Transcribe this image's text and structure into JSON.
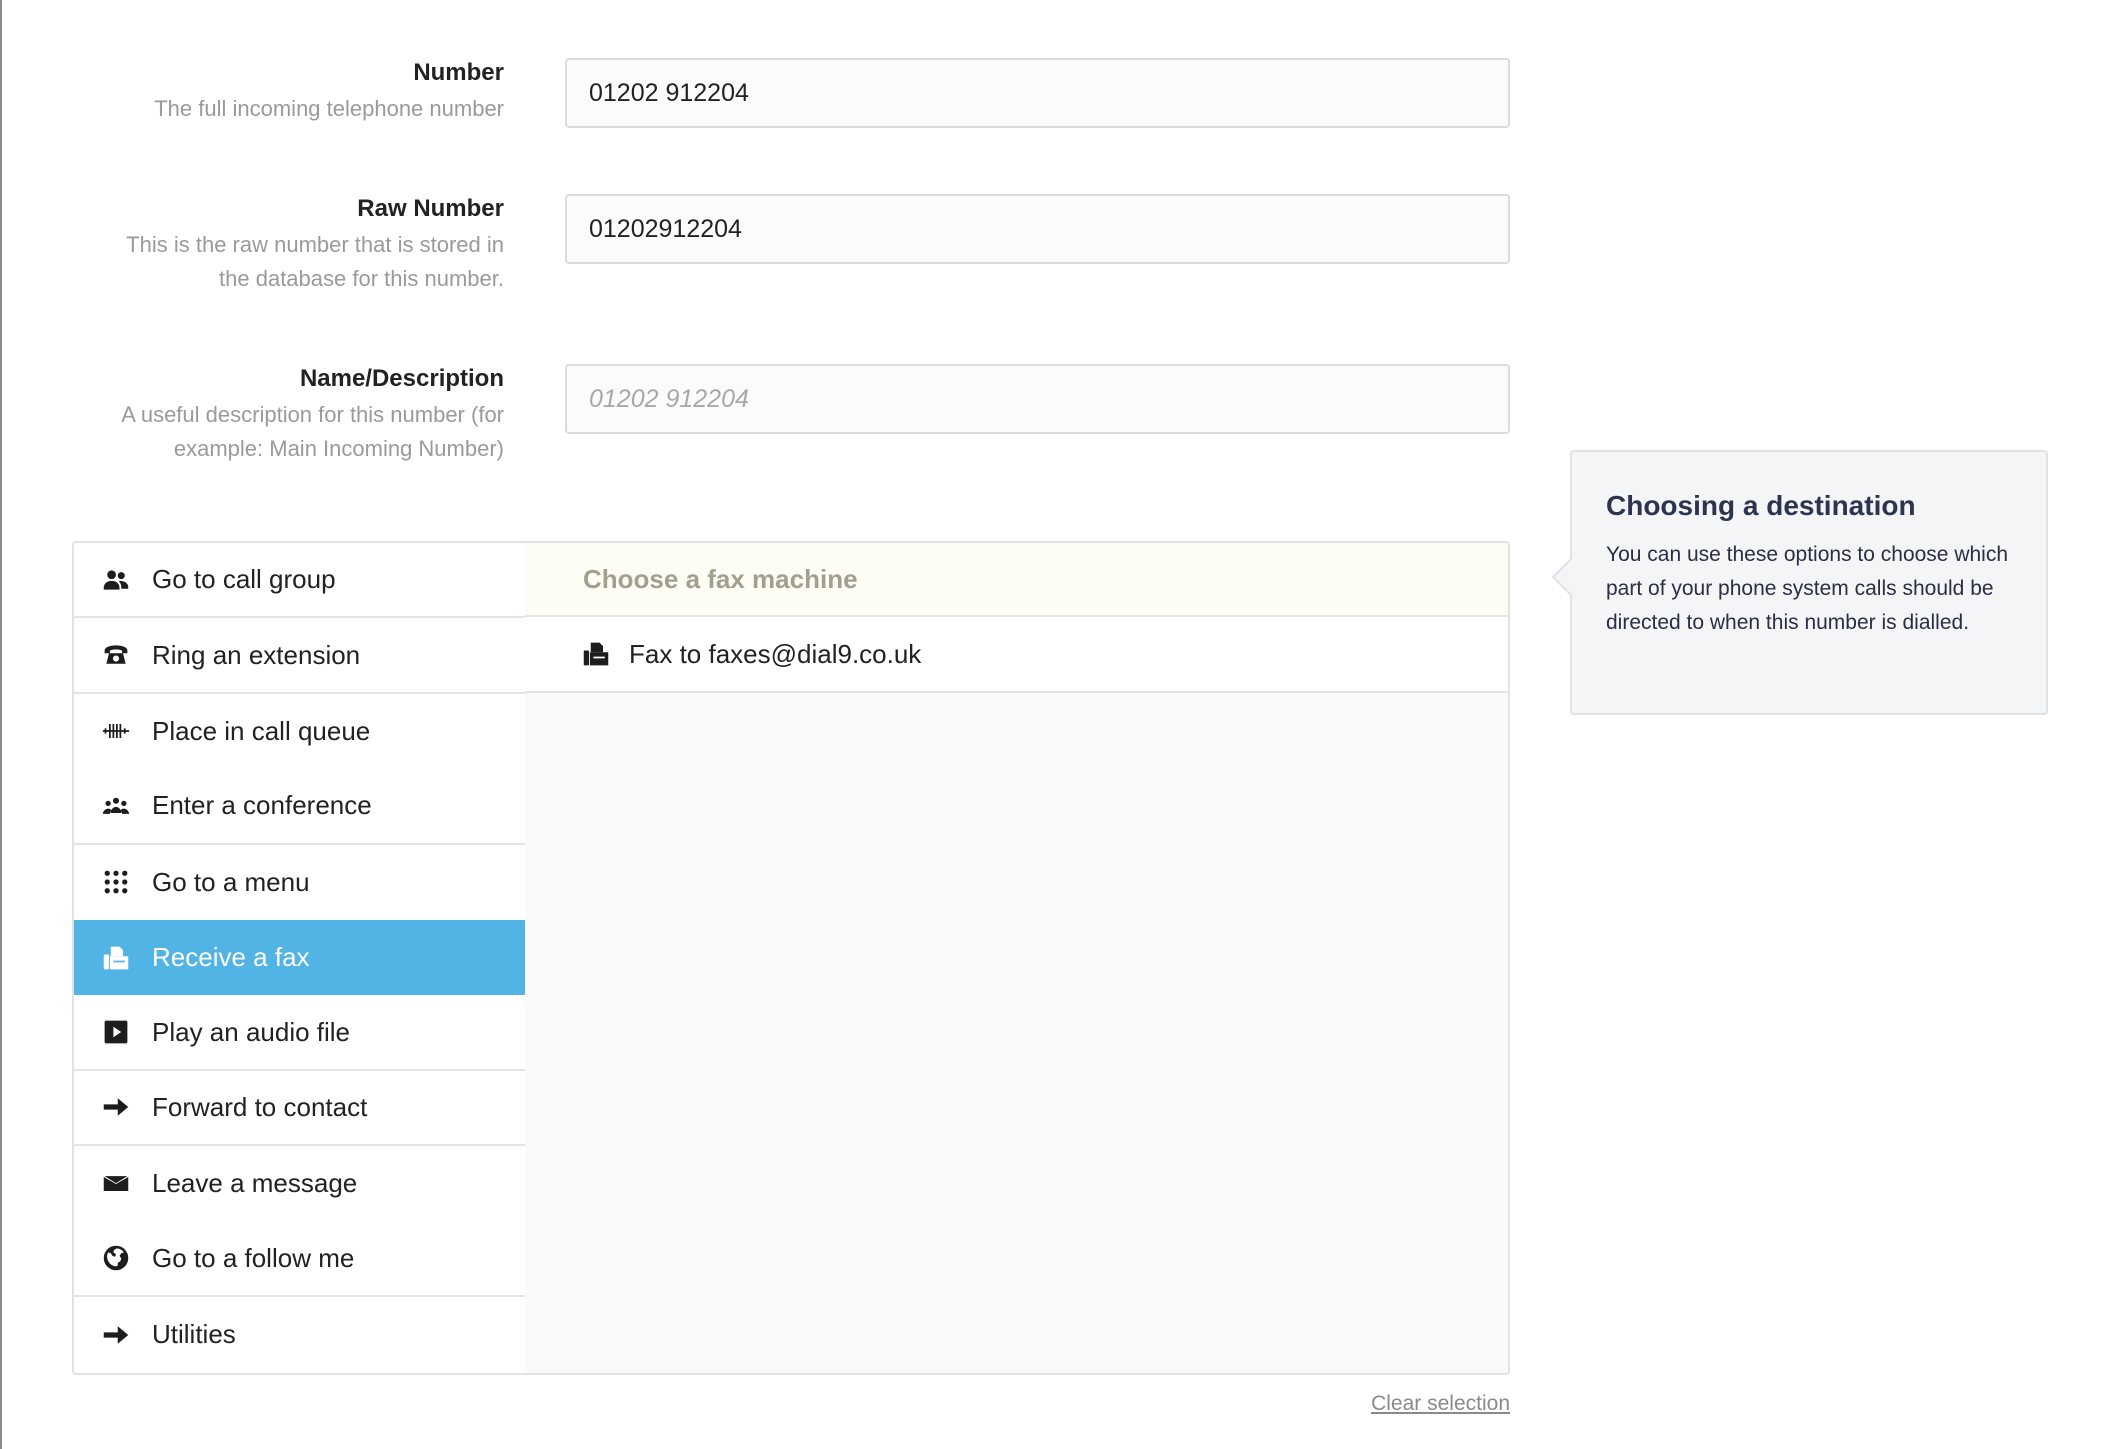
{
  "fields": {
    "number": {
      "label": "Number",
      "hint": "The full incoming telephone number",
      "value": "01202 912204"
    },
    "raw_number": {
      "label": "Raw Number",
      "hint_line1": "This is the raw number that is stored in",
      "hint_line2": "the database for this number.",
      "value": "01202912204"
    },
    "name_description": {
      "label": "Name/Description",
      "hint_line1": "A useful description for this number (for",
      "hint_line2": "example: Main Incoming Number)",
      "placeholder": "01202 912204"
    }
  },
  "destinations": {
    "items": [
      {
        "label": "Go to call group",
        "icon": "users-icon"
      },
      {
        "label": "Ring an extension",
        "icon": "phone-icon"
      },
      {
        "label": "Place in call queue",
        "icon": "queue-icon"
      },
      {
        "label": "Enter a conference",
        "icon": "conference-icon"
      },
      {
        "label": "Go to a menu",
        "icon": "keypad-icon"
      },
      {
        "label": "Receive a fax",
        "icon": "fax-icon",
        "active": true
      },
      {
        "label": "Play an audio file",
        "icon": "play-icon"
      },
      {
        "label": "Forward to contact",
        "icon": "arrow-right-icon"
      },
      {
        "label": "Leave a message",
        "icon": "envelope-icon"
      },
      {
        "label": "Go to a follow me",
        "icon": "globe-icon"
      },
      {
        "label": "Utilities",
        "icon": "arrow-right-icon"
      }
    ],
    "panel_heading": "Choose a fax machine",
    "options": [
      {
        "label": "Fax to faxes@dial9.co.uk",
        "icon": "fax-icon"
      }
    ]
  },
  "help": {
    "title": "Choosing a destination",
    "body": "You can use these options to choose which part of your phone system calls should be directed to when this number is dialled."
  },
  "clear_selection": "Clear selection",
  "colors": {
    "active_item": "#52b3e5",
    "heading_text": "#a29f8e",
    "help_title": "#2e3450"
  }
}
